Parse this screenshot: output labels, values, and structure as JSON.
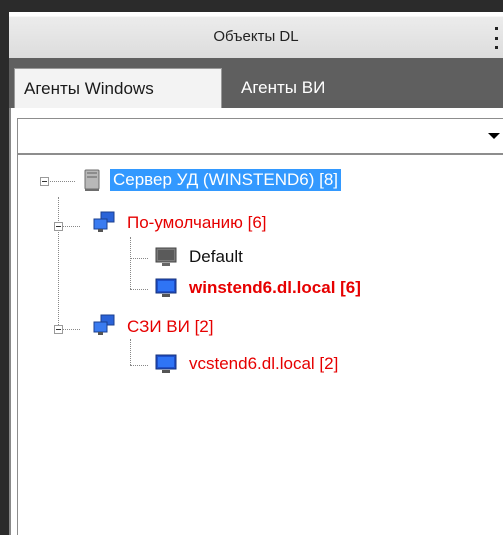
{
  "panel": {
    "title": "Объекты DL"
  },
  "tabs": [
    {
      "label": "Агенты Windows",
      "active": true
    },
    {
      "label": "Агенты ВИ",
      "active": false
    }
  ],
  "filter": {
    "value": ""
  },
  "tree": {
    "root": {
      "label": "Сервер УД (WINSTEND6) [8]",
      "icon": "server-icon",
      "selected": true
    },
    "groups": [
      {
        "label": "По-умолчанию [6]",
        "icon": "network-group-icon",
        "children": [
          {
            "label": "Default",
            "icon": "computer-offline-icon"
          },
          {
            "label": "winstend6.dl.local [6]",
            "icon": "computer-online-icon"
          }
        ]
      },
      {
        "label": "СЗИ ВИ [2]",
        "icon": "network-group-icon",
        "children": [
          {
            "label": "vcstend6.dl.local [2]",
            "icon": "computer-online-icon"
          }
        ]
      }
    ]
  },
  "colors": {
    "selection": "#3399ff",
    "agent_group_text": "#e60000",
    "tab_strip": "#5f5f5f"
  }
}
